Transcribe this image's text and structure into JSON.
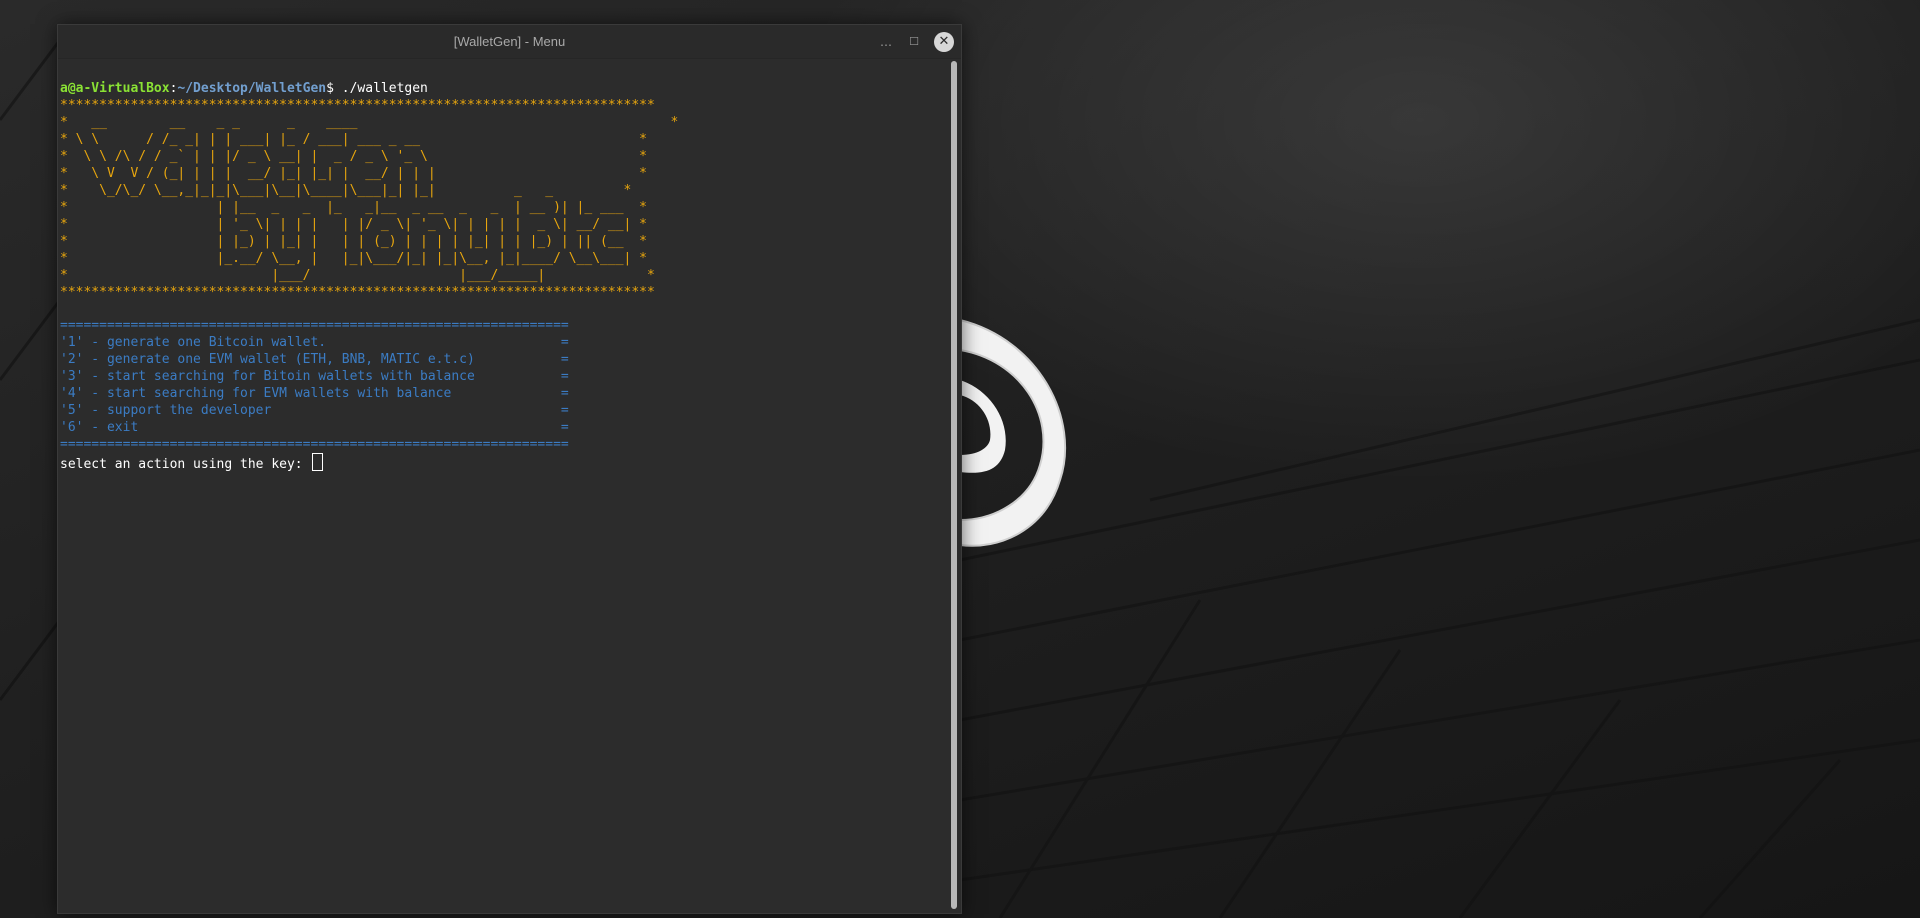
{
  "window": {
    "title": "[WalletGen] - Menu",
    "minimize_glyph": "…",
    "maximize_glyph": "☐",
    "close_glyph": "✕"
  },
  "terminal": {
    "prompt_user": "a@a-VirtualBox",
    "prompt_sep": ":",
    "prompt_path": "~/Desktop/WalletGen",
    "prompt_symbol": "$ ",
    "command": "./walletgen",
    "banner": "****************************************************************************\n*   __        __    _ _      _    ____                                        *\n* \\ \\      / /_ _| | | ___| |_ / ___| ___ _ __                            *\n*  \\ \\ /\\ / / _` | | |/ _ \\ __| |  _ / _ \\ '_ \\                           *\n*   \\ V  V / (_| | | |  __/ |_| |_| |  __/ | | |                          *\n*    \\_/\\_/ \\__,_|_|_|\\___|\\__|\\____|\\___|_| |_|          _   _         *\n*                   | |__  _   _  |_   _|__  _ __  _   _  | __ )| |_ ___  *\n*                   | '_ \\| | | |   | |/ _ \\| '_ \\| | | | |  _ \\| __/ __| *\n*                   | |_) | |_| |   | | (_) | | | | |_| | | |_) | || (__  *\n*                   |_.__/ \\__, |   |_|\\___/|_| |_|\\__, |_|____/ \\__\\___| *\n*                          |___/                   |___/_____|             *\n****************************************************************************",
    "menu_rule": "=================================================================",
    "menu_items": [
      "'1' - generate one Bitcoin wallet.                              =",
      "'2' - generate one EVM wallet (ETH, BNB, MATIC e.t.c)           =",
      "'3' - start searching for Bitoin wallets with balance           =",
      "'4' - start searching for EVM wallets with balance              =",
      "'5' - support the developer                                     =",
      "'6' - exit                                                      ="
    ],
    "input_prompt": "select an action using the key: "
  },
  "colors": {
    "banner": "#e8a60e",
    "menu": "#3b7cc4",
    "prompt_user": "#8ae234",
    "prompt_path": "#729fcf"
  }
}
